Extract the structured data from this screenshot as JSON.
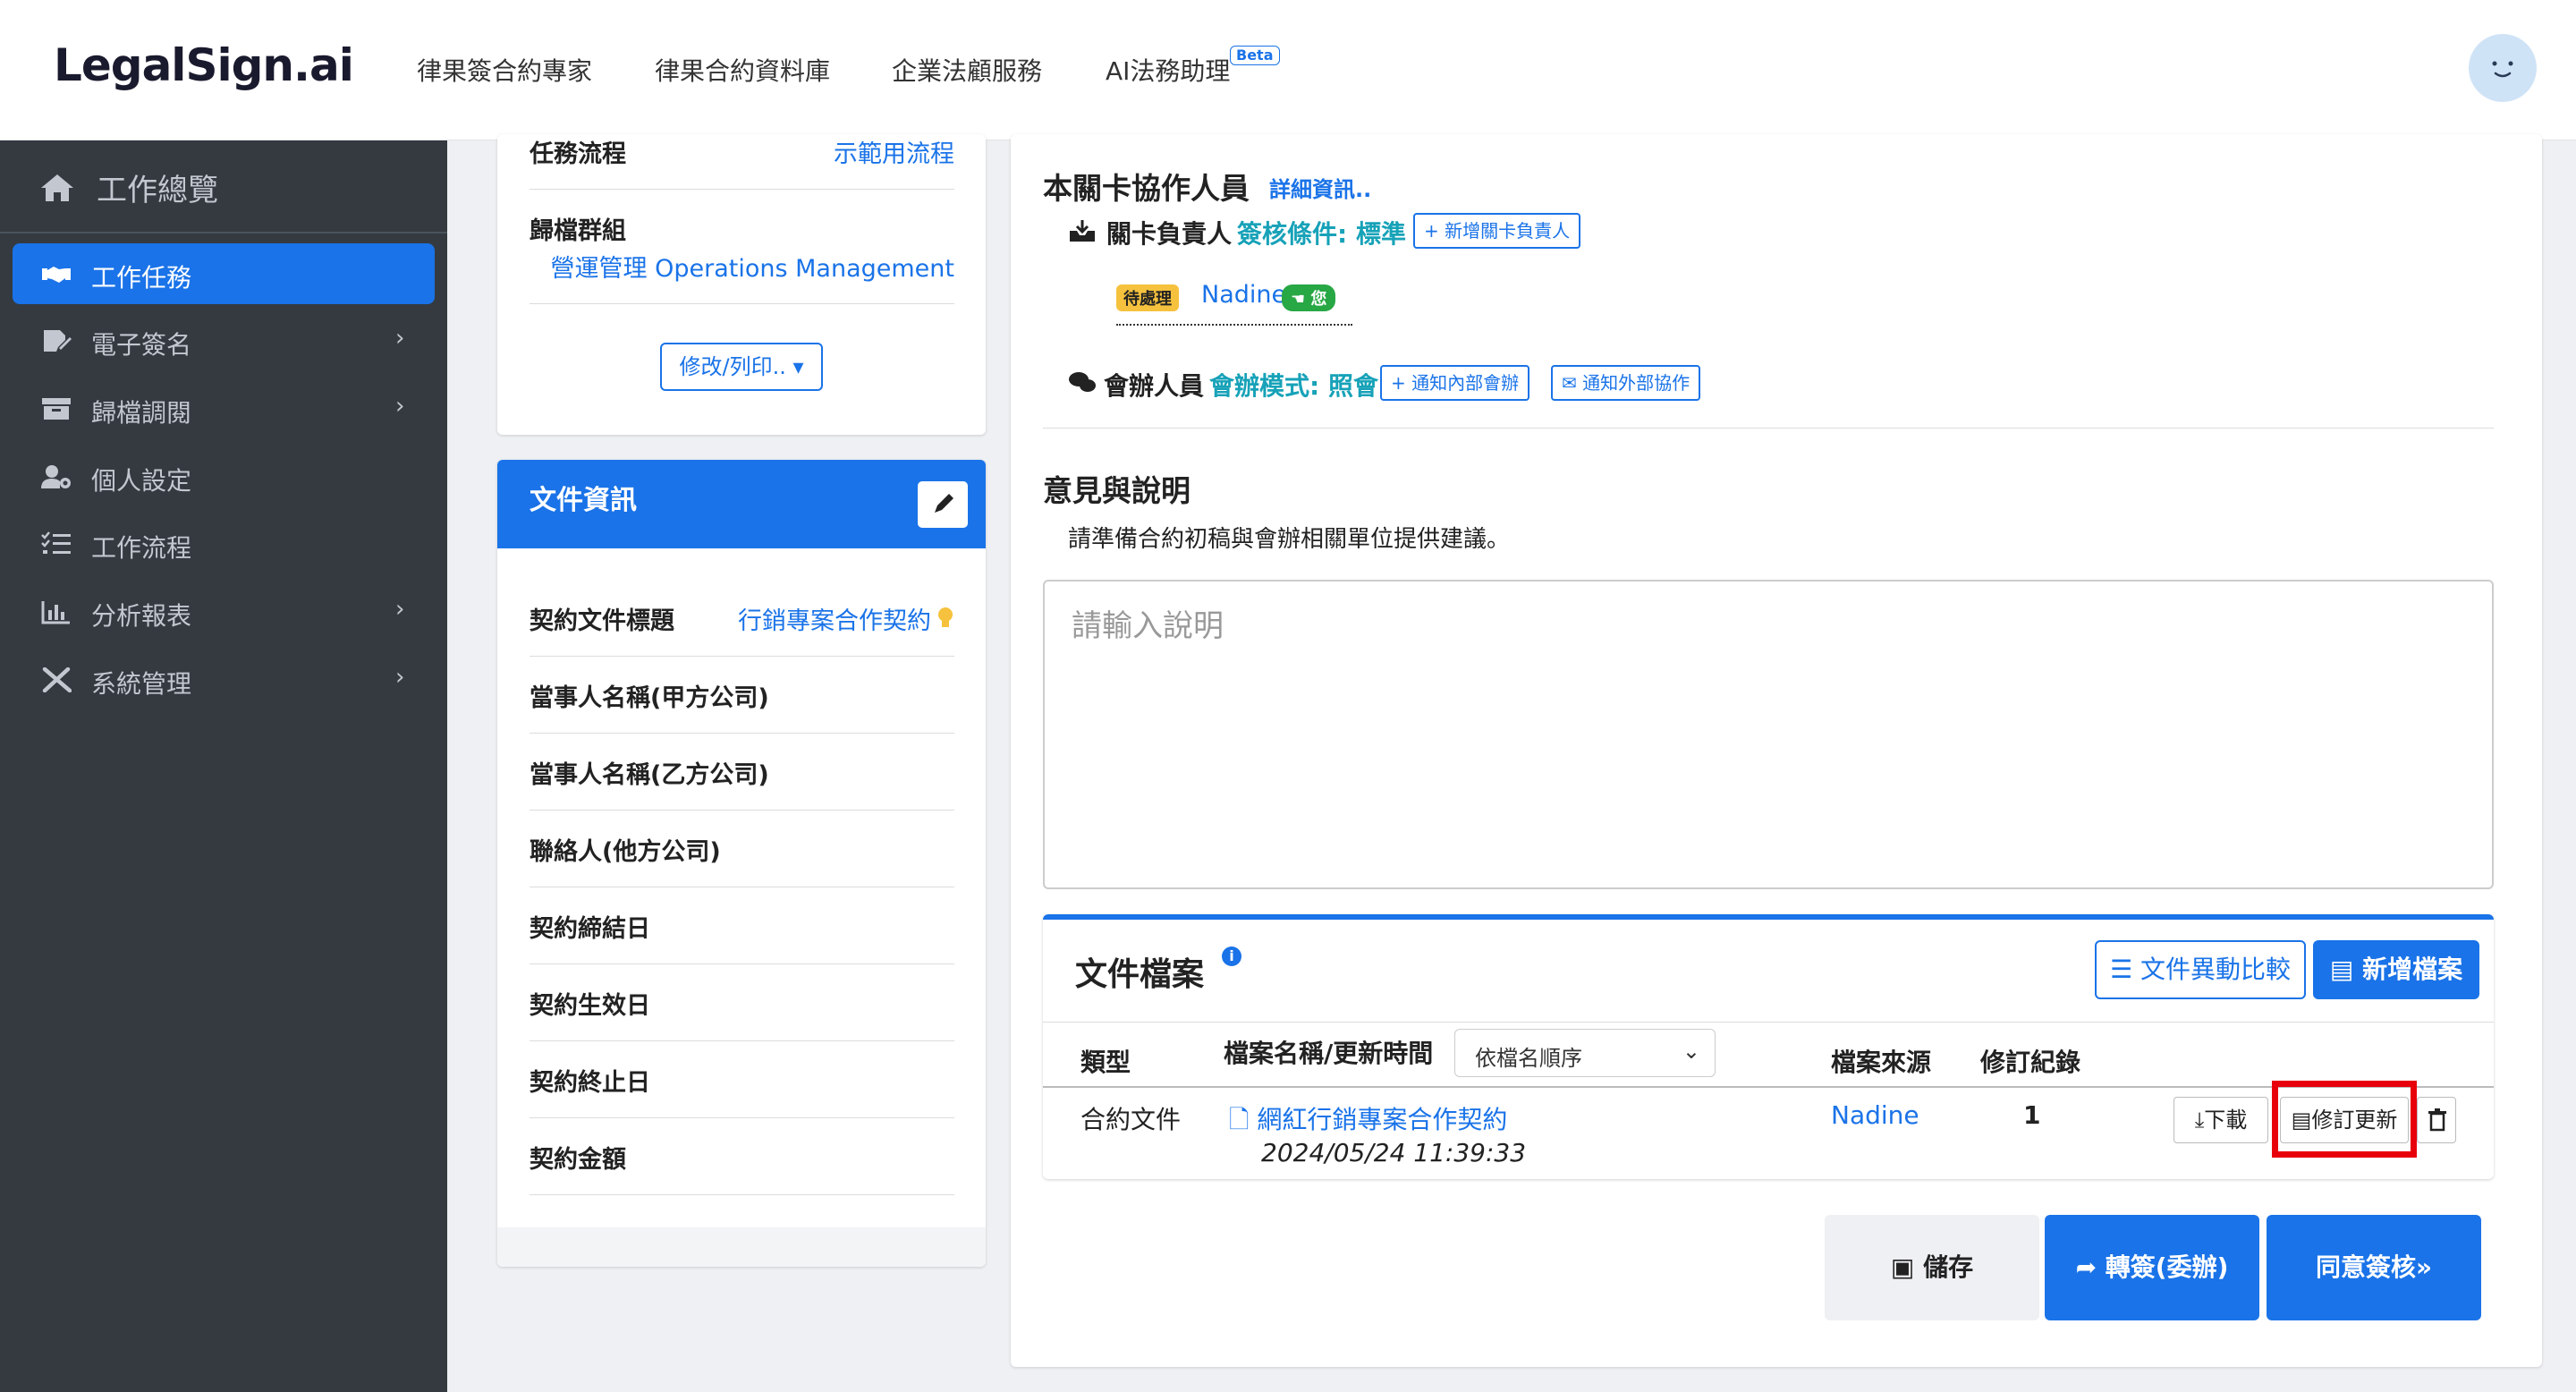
{
  "header": {
    "logo": "LegalSign.ai",
    "nav": [
      "律果簽合約專家",
      "律果合約資料庫",
      "企業法顧服務",
      "AI法務助理"
    ],
    "beta_badge": "Beta"
  },
  "sidebar": {
    "top": "工作總覽",
    "items": [
      {
        "label": "工作任務",
        "icon": "handshake-icon",
        "active": true,
        "chevron": false
      },
      {
        "label": "電子簽名",
        "icon": "signature-icon",
        "active": false,
        "chevron": true
      },
      {
        "label": "歸檔調閱",
        "icon": "archive-icon",
        "active": false,
        "chevron": true
      },
      {
        "label": "個人設定",
        "icon": "user-cog-icon",
        "active": false,
        "chevron": false
      },
      {
        "label": "工作流程",
        "icon": "list-check-icon",
        "active": false,
        "chevron": false
      },
      {
        "label": "分析報表",
        "icon": "bar-chart-icon",
        "active": false,
        "chevron": true
      },
      {
        "label": "系統管理",
        "icon": "tools-icon",
        "active": false,
        "chevron": true
      }
    ],
    "chevron_glyph": "›"
  },
  "task_card": {
    "workflow_label": "任務流程",
    "workflow_value": "示範用流程",
    "group_label": "歸檔群組",
    "group_value": "營運管理 Operations Management",
    "print_button": "修改/列印.. ▾"
  },
  "doc_info": {
    "title": "文件資訊",
    "fields": [
      {
        "label": "契約文件標題",
        "value": "行銷專案合作契約"
      },
      {
        "label": "當事人名稱(甲方公司)",
        "value": ""
      },
      {
        "label": "當事人名稱(乙方公司)",
        "value": ""
      },
      {
        "label": "聯絡人(他方公司)",
        "value": ""
      },
      {
        "label": "契約締結日",
        "value": ""
      },
      {
        "label": "契約生效日",
        "value": ""
      },
      {
        "label": "契約終止日",
        "value": ""
      },
      {
        "label": "契約金額",
        "value": ""
      }
    ]
  },
  "stage": {
    "title": "本關卡協作人員",
    "details_link": "詳細資訊..",
    "owner_label": "關卡負責人",
    "sign_condition": "簽核條件: 標準",
    "add_owner_button": "新增關卡負責人",
    "pending_badge": "待處理",
    "assignee": "Nadine",
    "you_badge": "您",
    "co_label": "會辦人員",
    "co_mode": "會辦模式: 照會",
    "notify_internal_button": "通知內部會辦",
    "notify_external_button": "通知外部協作"
  },
  "opinion": {
    "title": "意見與說明",
    "description": "請準備合約初稿與會辦相關單位提供建議。",
    "placeholder": "請輸入說明"
  },
  "files": {
    "title": "文件檔案",
    "info_icon": "i",
    "compare_button": "文件異動比較",
    "add_button": "新增檔案",
    "columns": {
      "type": "類型",
      "name": "檔案名稱/更新時間",
      "source": "檔案來源",
      "revisions": "修訂紀錄"
    },
    "sort_select": "依檔名順序",
    "rows": [
      {
        "type": "合約文件",
        "name": "網紅行銷專案合作契約",
        "time": "2024/05/24 11:39:33",
        "source": "Nadine",
        "revisions": "1",
        "download": "下載",
        "revise": "修訂更新"
      }
    ]
  },
  "actions": {
    "save": "儲存",
    "transfer": "轉簽(委辦)",
    "approve": "同意簽核»"
  },
  "colors": {
    "primary": "#1a73e8",
    "sidebar_bg": "#343a40",
    "pending_badge": "#f6c23e",
    "you_badge": "#28a745",
    "highlight": "#e8000b"
  }
}
